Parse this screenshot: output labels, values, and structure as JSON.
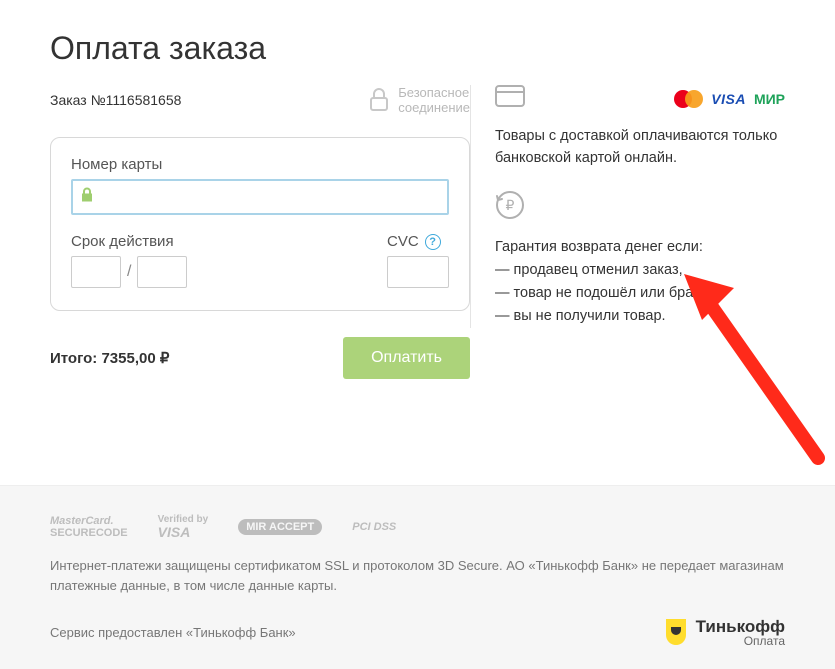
{
  "header": {
    "title": "Оплата заказа"
  },
  "order": {
    "label": "Заказ №1116581658"
  },
  "secure": {
    "line1": "Безопасное",
    "line2": "соединение"
  },
  "card": {
    "number_label": "Номер карты",
    "expiry_label": "Срок действия",
    "cvc_label": "CVC",
    "slash": "/"
  },
  "total": {
    "label": "Итого: 7355,00 ₽"
  },
  "pay_button": {
    "label": "Оплатить"
  },
  "info": {
    "delivery_text": "Товары с доставкой оплачиваются только банковской картой онлайн.",
    "guarantee_title": "Гарантия возврата денег если:",
    "g1": "— продавец отменил заказ,",
    "g2": "— товар не подошёл или брак,",
    "g3": "— вы не получили товар."
  },
  "payment_logos": {
    "visa": "VISA",
    "mir": "МИР"
  },
  "footer": {
    "logo1_l1": "MasterCard.",
    "logo1_l2": "SECURECODE",
    "logo2_l1": "Verified by",
    "logo2_l2": "VISA",
    "logo3": "MIR ACCEPT",
    "logo4": "PCI DSS",
    "text": "Интернет-платежи защищены сертификатом SSL и протоколом 3D Secure. АО «Тинькофф Банк» не передает магазинам платежные данные, в том числе данные карты.",
    "service_by": "Сервис предоставлен «Тинькофф Банк»",
    "tinkoff_name": "Тинькофф",
    "tinkoff_sub": "Оплата"
  }
}
